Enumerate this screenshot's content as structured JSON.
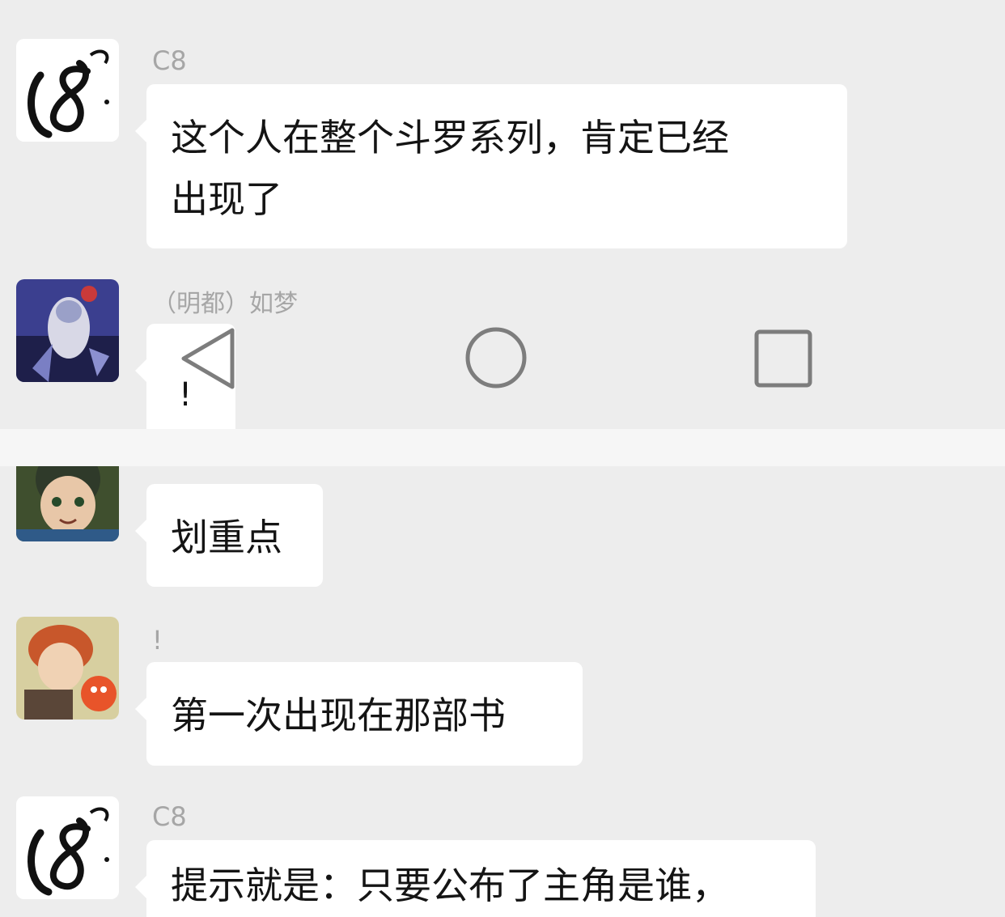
{
  "messages": [
    {
      "sender": "C8",
      "text": "这个人在整个斗罗系列，肯定已经\n出现了"
    },
    {
      "sender": "（明都）如梦",
      "text": "!"
    },
    {
      "sender": "",
      "text": "划重点"
    },
    {
      "sender": "!",
      "text": "第一次出现在那部书"
    },
    {
      "sender": "C8",
      "text": "提示就是：只要公布了主角是谁，"
    }
  ],
  "nav": {
    "back_icon": "triangle-back-icon",
    "home_icon": "circle-home-icon",
    "recents_icon": "square-recents-icon"
  },
  "colors": {
    "background": "#ededed",
    "bubble": "#ffffff",
    "name": "#a6a6a6",
    "text": "#141414"
  }
}
